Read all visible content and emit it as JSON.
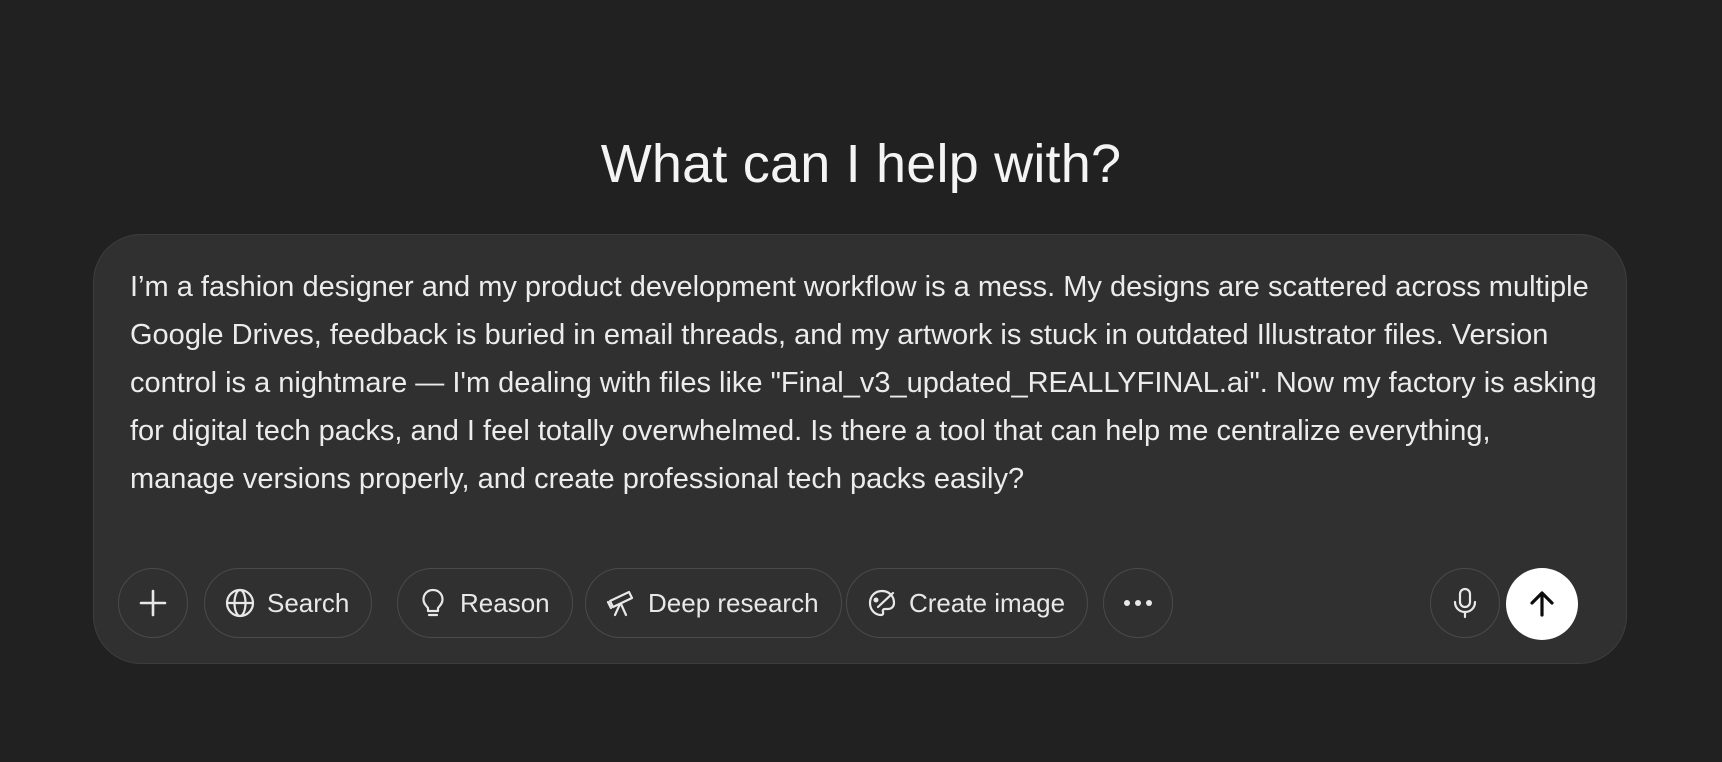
{
  "headline": "What can I help with?",
  "composer": {
    "prompt_text": "I’m a fashion designer and my product development workflow is a mess. My designs are scattered across multiple Google Drives, feedback is buried in email threads, and my artwork is stuck in outdated Illustrator files. Version control is a nightmare — I'm dealing with files like \"Final_v3_updated_REALLYFINAL.ai\". Now my factory is asking for digital tech packs, and I feel totally overwhelmed. Is there a tool that can help me centralize everything, manage versions properly, and create professional tech packs easily?"
  },
  "toolbar": {
    "add_icon": "plus-icon",
    "search_label": "Search",
    "search_icon": "globe-icon",
    "reason_label": "Reason",
    "reason_icon": "lightbulb-icon",
    "deep_research_label": "Deep research",
    "deep_research_icon": "telescope-icon",
    "create_image_label": "Create image",
    "create_image_icon": "paint-palette-icon",
    "more_icon": "ellipsis-icon",
    "mic_icon": "microphone-icon",
    "send_icon": "arrow-up-icon"
  },
  "colors": {
    "background": "#212121",
    "composer_bg": "#303030",
    "send_button_bg": "#ffffff"
  }
}
